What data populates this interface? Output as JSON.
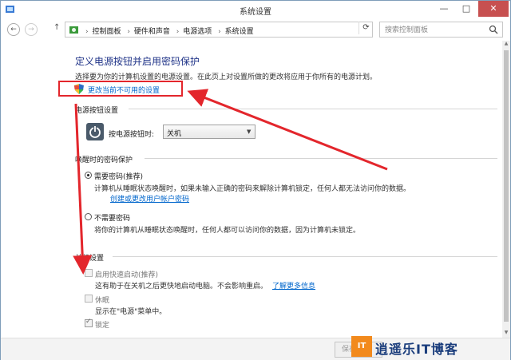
{
  "window": {
    "title": "系统设置"
  },
  "address": {
    "crumbs": [
      "控制面板",
      "硬件和声音",
      "电源选项",
      "系统设置"
    ],
    "search_placeholder": "搜索控制面板"
  },
  "page": {
    "title": "定义电源按钮并启用密码保护",
    "description": "选择要为你的计算机设置的电源设置。在此页上对设置所做的更改将应用于你所有的电源计划。",
    "change_link": "更改当前不可用的设置"
  },
  "power_buttons": {
    "header": "电源按钮设置",
    "label": "按电源按钮时:",
    "selected": "关机"
  },
  "password": {
    "header": "唤醒时的密码保护",
    "require_label": "需要密码(推荐)",
    "require_desc": "计算机从睡眠状态唤醒时，如果未输入正确的密码来解除计算机锁定，任何人都无法访问你的数据。",
    "create_link": "创建或更改用户帐户密码",
    "no_require_label": "不需要密码",
    "no_require_desc": "将你的计算机从睡眠状态唤醒时，任何人都可以访问你的数据，因为计算机未锁定。"
  },
  "shutdown": {
    "header": "关机设置",
    "fast_label": "启用快速启动(推荐)",
    "fast_desc": "这有助于在关机之后更快地启动电脑。不会影响重启。",
    "learn_more": "了解更多信息",
    "sleep_label": "休眠",
    "sleep_desc": "显示在\"电源\"菜单中。",
    "lock_label": "锁定"
  },
  "footer": {
    "save_label": "保存"
  },
  "watermark": {
    "logo": "IT",
    "text": "逍遥乐IT博客"
  },
  "colors": {
    "title": "#1e3287",
    "link": "#0066cc",
    "highlight": "#e3262c",
    "close": "#c75050"
  }
}
